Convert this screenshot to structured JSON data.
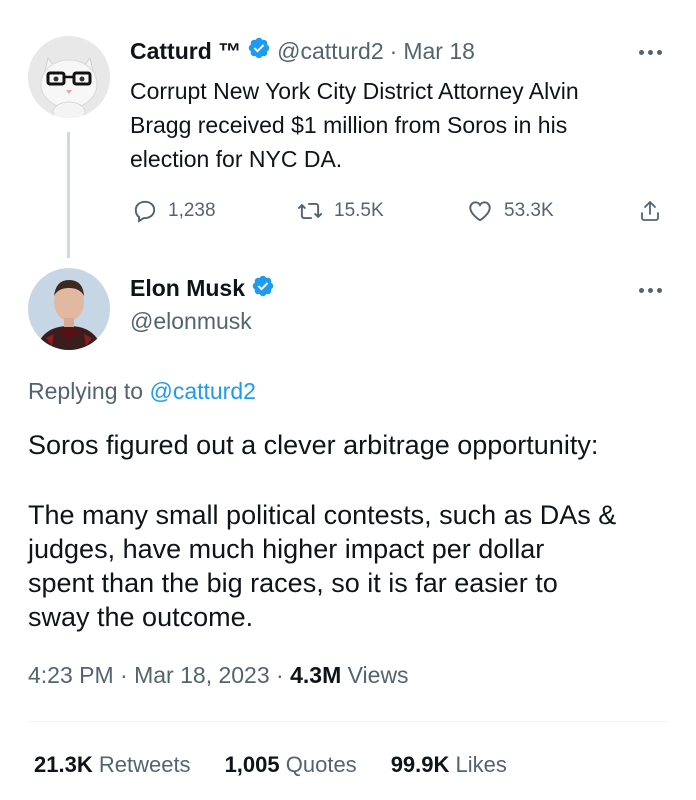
{
  "parent_tweet": {
    "display_name": "Catturd ™",
    "handle": "@catturd2",
    "date": "Mar 18",
    "text_lines": [
      "Corrupt New York City District Attorney Alvin",
      "Bragg received $1 million from Soros in his",
      "election for NYC DA."
    ],
    "replies": "1,238",
    "retweets": "15.5K",
    "likes": "53.3K"
  },
  "reply_tweet": {
    "display_name": "Elon Musk",
    "handle": "@elonmusk",
    "replying_prefix": "Replying to",
    "replying_to": "@catturd2",
    "text_line1": "Soros figured out a clever arbitrage opportunity:",
    "text_lines2": [
      "The many small political contests, such as DAs &",
      "judges, have much higher impact per dollar",
      "spent than the big races, so it is far easier to",
      "sway the outcome."
    ],
    "time": "4:23 PM",
    "date": "Mar 18, 2023",
    "views_count": "4.3M",
    "views_label": "Views"
  },
  "stats": {
    "retweets_count": "21.3K",
    "retweets_label": "Retweets",
    "quotes_count": "1,005",
    "quotes_label": "Quotes",
    "likes_count": "99.9K",
    "likes_label": "Likes"
  },
  "colors": {
    "accent": "#1d9bf0",
    "muted": "#536471",
    "text": "#0f1419"
  },
  "icons": [
    "verified-badge-icon",
    "more-options-icon",
    "reply-icon",
    "retweet-icon",
    "like-icon",
    "share-icon"
  ]
}
